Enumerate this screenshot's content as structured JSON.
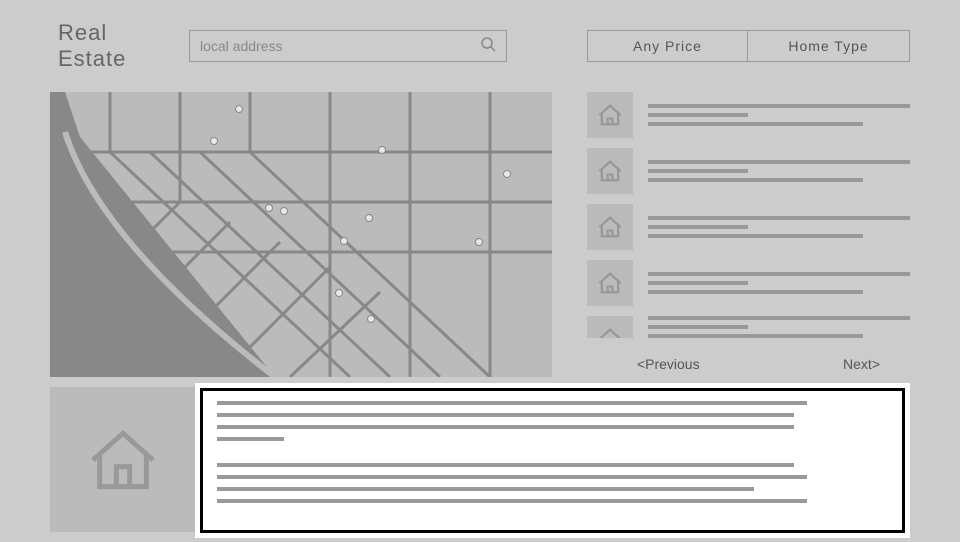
{
  "header": {
    "title": "Real Estate",
    "search_placeholder": "local address",
    "filter_price": "Any Price",
    "filter_type": "Home Type"
  },
  "pagination": {
    "prev": "<Previous",
    "next": "Next>"
  },
  "listings": [
    {
      "id": 1
    },
    {
      "id": 2
    },
    {
      "id": 3
    },
    {
      "id": 4
    },
    {
      "id": 5
    }
  ]
}
